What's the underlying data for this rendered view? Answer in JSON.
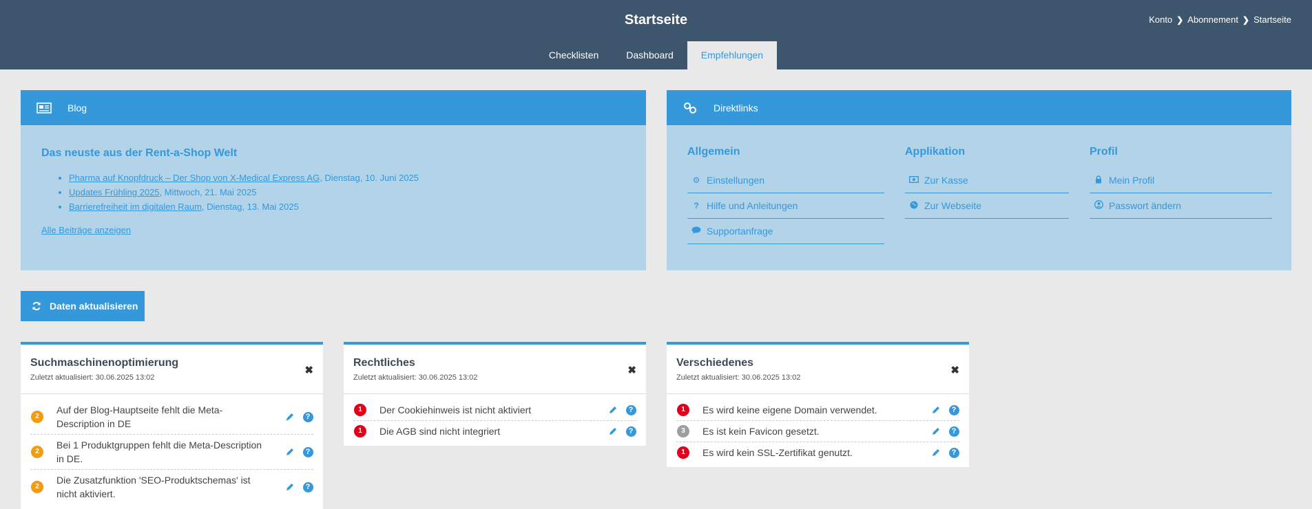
{
  "header": {
    "title": "Startseite",
    "breadcrumb": [
      "Konto",
      "Abonnement",
      "Startseite"
    ],
    "tabs": [
      {
        "label": "Checklisten",
        "active": false
      },
      {
        "label": "Dashboard",
        "active": false
      },
      {
        "label": "Empfehlungen",
        "active": true
      }
    ]
  },
  "blog": {
    "title": "Blog",
    "icon": "newspaper-icon",
    "heading": "Das neuste aus der Rent-a-Shop Welt",
    "posts": [
      {
        "link": "Pharma auf Knopfdruck – Der Shop von X-Medical Express AG",
        "date": ", Dienstag, 10. Juni 2025"
      },
      {
        "link": "Updates Frühling 2025",
        "date": ", Mittwoch, 21. Mai 2025"
      },
      {
        "link": "Barrierefreiheit im digitalen Raum",
        "date": ", Dienstag, 13. Mai 2025"
      }
    ],
    "all_link": "Alle Beiträge anzeigen"
  },
  "direktlinks": {
    "title": "Direktlinks",
    "icon": "link-icon",
    "columns": [
      {
        "heading": "Allgemein",
        "links": [
          {
            "label": "Einstellungen",
            "icon": "gear-icon"
          },
          {
            "label": "Hilfe und Anleitungen",
            "icon": "question-icon"
          },
          {
            "label": "Supportanfrage",
            "icon": "chat-bubble-icon"
          }
        ]
      },
      {
        "heading": "Applikation",
        "links": [
          {
            "label": "Zur Kasse",
            "icon": "money-icon"
          },
          {
            "label": "Zur Webseite",
            "icon": "globe-icon"
          }
        ]
      },
      {
        "heading": "Profil",
        "links": [
          {
            "label": "Mein Profil",
            "icon": "lock-icon"
          },
          {
            "label": "Passwort ändern",
            "icon": "user-circle-icon"
          }
        ]
      }
    ]
  },
  "refresh_button": "Daten aktualisieren",
  "colors": {
    "orange": "#f39c12",
    "red": "#e3001b",
    "grey": "#9e9e9e",
    "blue": "#3498db"
  },
  "cards": [
    {
      "title": "Suchmaschinenoptimierung",
      "updated": "Zuletzt aktualisiert: 30.06.2025 13:02",
      "items": [
        {
          "count": "2",
          "level": "orange",
          "text": "Auf der Blog-Hauptseite fehlt die Meta-Description in DE"
        },
        {
          "count": "2",
          "level": "orange",
          "text": "Bei 1 Produktgruppen fehlt die Meta-Description in DE."
        },
        {
          "count": "2",
          "level": "orange",
          "text": "Die Zusatzfunktion 'SEO-Produktschemas' ist nicht aktiviert."
        }
      ]
    },
    {
      "title": "Rechtliches",
      "updated": "Zuletzt aktualisiert: 30.06.2025 13:02",
      "items": [
        {
          "count": "1",
          "level": "red",
          "text": "Der Cookiehinweis ist nicht aktiviert"
        },
        {
          "count": "1",
          "level": "red",
          "text": "Die AGB sind nicht integriert"
        }
      ]
    },
    {
      "title": "Verschiedenes",
      "updated": "Zuletzt aktualisiert: 30.06.2025 13:02",
      "items": [
        {
          "count": "1",
          "level": "red",
          "text": "Es wird keine eigene Domain verwendet."
        },
        {
          "count": "3",
          "level": "grey",
          "text": "Es ist kein Favicon gesetzt."
        },
        {
          "count": "1",
          "level": "red",
          "text": "Es wird kein SSL-Zertifikat genutzt."
        }
      ]
    }
  ]
}
